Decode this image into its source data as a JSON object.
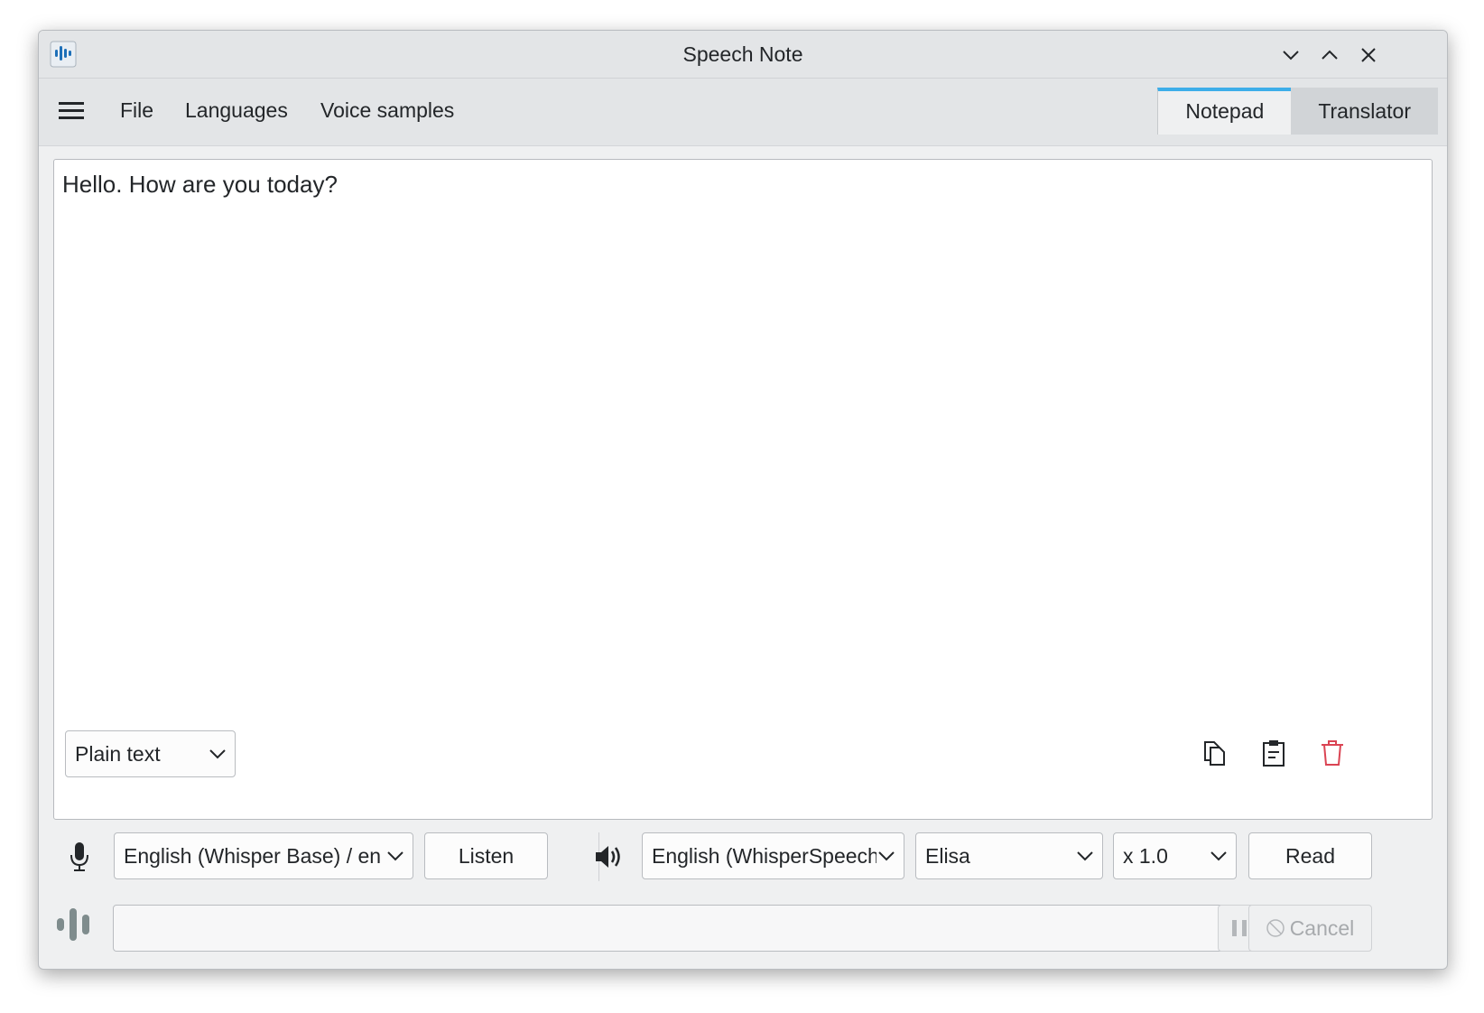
{
  "window": {
    "title": "Speech Note"
  },
  "menu": {
    "file": "File",
    "languages": "Languages",
    "voice_samples": "Voice samples"
  },
  "tabs": {
    "notepad": "Notepad",
    "translator": "Translator",
    "active": "notepad"
  },
  "editor": {
    "text": "Hello. How are you today?",
    "format": "Plain text"
  },
  "stt": {
    "language": "English (Whisper Base) / en",
    "listen_label": "Listen"
  },
  "tts": {
    "model": "English (WhisperSpeech",
    "voice": "Elisa",
    "speed": "x 1.0",
    "read_label": "Read"
  },
  "status": {
    "cancel_label": "Cancel"
  },
  "colors": {
    "accent": "#3daee9",
    "app_icon": "#1d6fb8",
    "delete_icon": "#da4453"
  },
  "icons": [
    "app-icon",
    "minimize-icon",
    "maximize-icon",
    "close-icon",
    "hamburger-icon",
    "copy-icon",
    "paste-icon",
    "delete-icon",
    "microphone-icon",
    "speaker-icon",
    "audio-level-icon",
    "pause-icon",
    "cancel-icon",
    "chevron-down-icon"
  ]
}
